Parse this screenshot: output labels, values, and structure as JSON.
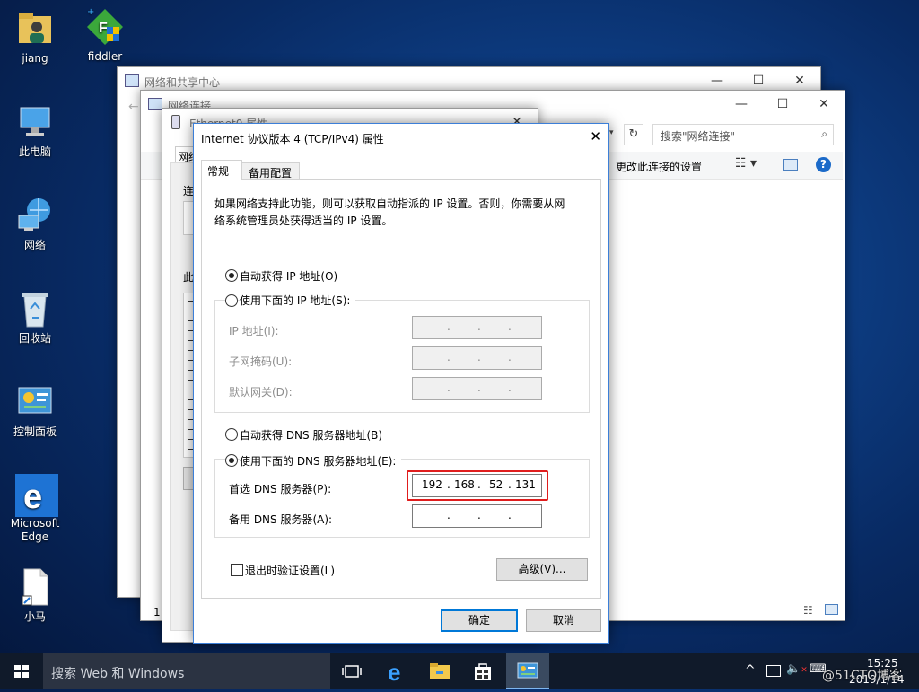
{
  "desktop": {
    "icons": [
      {
        "label": "jiang",
        "icon": "user-folder-icon"
      },
      {
        "label": "fiddler",
        "icon": "fiddler-icon"
      },
      {
        "label": "此电脑",
        "icon": "computer-icon"
      },
      {
        "label": "网络",
        "icon": "network-icon"
      },
      {
        "label": "回收站",
        "icon": "recycle-bin-icon"
      },
      {
        "label": "控制面板",
        "icon": "control-panel-icon"
      },
      {
        "label": "Microsoft Edge",
        "icon": "edge-icon"
      },
      {
        "label": "小马",
        "icon": "file-icon"
      }
    ]
  },
  "windows": {
    "network_center": {
      "title": "网络和共享中心"
    },
    "network_connections": {
      "title": "网络连接",
      "search_placeholder": "搜索\"网络连接\"",
      "toolbar_change_settings": "更改此连接的设置",
      "left_fragment_1": "网络",
      "left_fragment_2": "连",
      "left_fragment_3": "此",
      "status_count": "1"
    },
    "ethernet_props": {
      "title": "Ethernet0 属性",
      "tab": "网络"
    }
  },
  "dialog": {
    "title": "Internet 协议版本 4 (TCP/IPv4) 属性",
    "tabs": [
      "常规",
      "备用配置"
    ],
    "description": [
      "如果网络支持此功能，则可以获取自动指派的 IP 设置。否则，你需要从网",
      "络系统管理员处获得适当的 IP 设置。"
    ],
    "auto_ip_label": "自动获得 IP 地址(O)",
    "manual_ip_label": "使用下面的 IP 地址(S):",
    "ip_address_label": "IP 地址(I):",
    "subnet_mask_label": "子网掩码(U):",
    "gateway_label": "默认网关(D):",
    "auto_dns_label": "自动获得 DNS 服务器地址(B)",
    "manual_dns_label": "使用下面的 DNS 服务器地址(E):",
    "preferred_dns_label": "首选 DNS 服务器(P):",
    "preferred_dns": [
      "192",
      "168",
      "52",
      "131"
    ],
    "alternate_dns_label": "备用 DNS 服务器(A):",
    "validate_label": "退出时验证设置(L)",
    "advanced_button": "高级(V)...",
    "ok_button": "确定",
    "cancel_button": "取消",
    "dot": "."
  },
  "taskbar": {
    "search_placeholder": "搜索 Web 和 Windows",
    "time": "15:25",
    "date": "2019/1/14",
    "watermark": "@51CTO博客"
  },
  "colors": {
    "accent": "#0078d7",
    "highlight_red": "#e01d1d"
  }
}
